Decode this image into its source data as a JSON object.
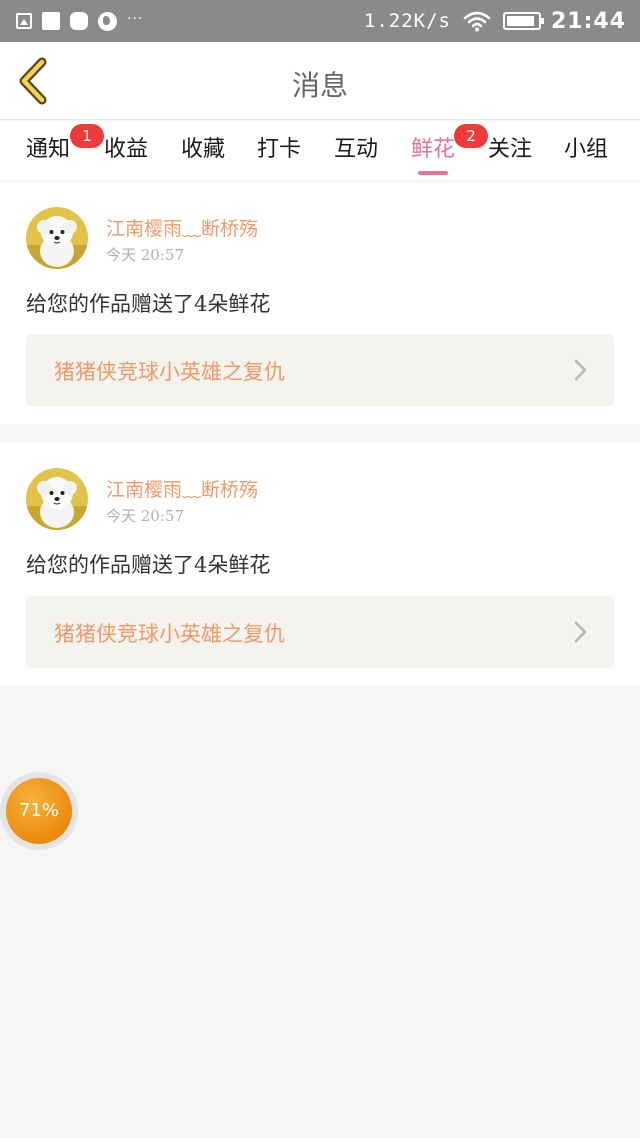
{
  "status_bar": {
    "dots": "···",
    "net_speed": "1.22K/s",
    "time": "21:44",
    "battery_level": 0.9,
    "icons": [
      "gallery-icon",
      "square-icon",
      "rounded-square-icon",
      "globe-icon",
      "wifi-icon",
      "battery-icon"
    ]
  },
  "header": {
    "title": "消息",
    "back_icon": "chevron-left-icon"
  },
  "tabs": [
    {
      "label": "通知",
      "badge": "1"
    },
    {
      "label": "收益",
      "badge": ""
    },
    {
      "label": "收藏",
      "badge": ""
    },
    {
      "label": "打卡",
      "badge": ""
    },
    {
      "label": "互动",
      "badge": ""
    },
    {
      "label": "鲜花",
      "badge": "2",
      "active": true
    },
    {
      "label": "关注",
      "badge": ""
    },
    {
      "label": "小组",
      "badge": ""
    }
  ],
  "messages": [
    {
      "user_name": "江南樱雨﹏断桥殇",
      "time": "今天 20:57",
      "text": "给您的作品赠送了4朵鲜花",
      "work_title": "猪猪侠竞球小英雄之复仇"
    },
    {
      "user_name": "江南樱雨﹏断桥殇",
      "time": "今天 20:57",
      "text": "给您的作品赠送了4朵鲜花",
      "work_title": "猪猪侠竞球小英雄之复仇"
    }
  ],
  "floating_progress": {
    "label": "71%",
    "value": 0.71
  },
  "colors": {
    "accent_pink": "#e8729b",
    "name_orange": "#f09a6a",
    "badge_red": "#ee3b3b",
    "status_bar_gray": "#8a8a8a"
  }
}
